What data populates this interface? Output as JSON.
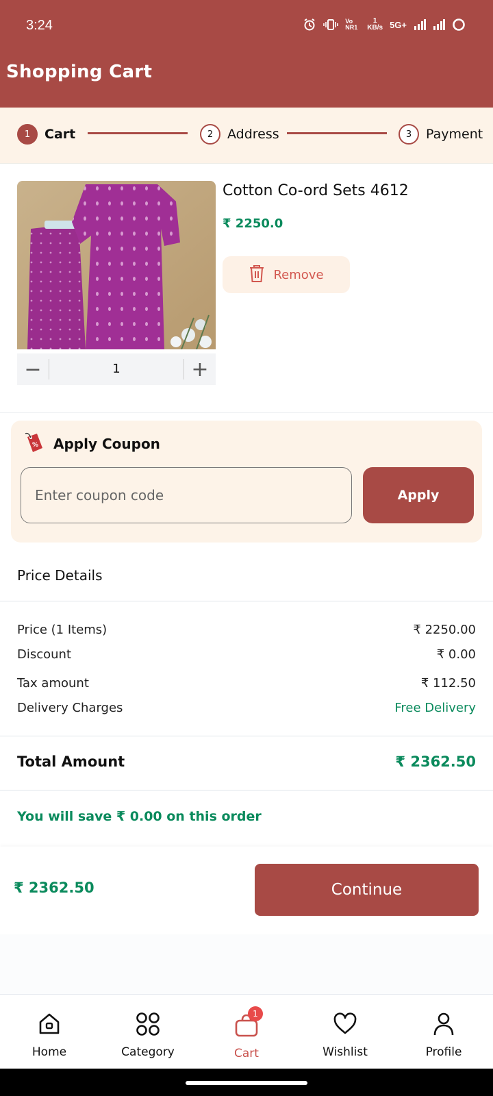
{
  "status": {
    "time": "3:24",
    "network": "5G+",
    "speed_top": "1",
    "speed_unit": "KB/s",
    "volte": "Vo NR1"
  },
  "header": {
    "title": "Shopping Cart"
  },
  "stepper": {
    "steps": [
      {
        "num": "1",
        "label": "Cart"
      },
      {
        "num": "2",
        "label": "Address"
      },
      {
        "num": "3",
        "label": "Payment"
      }
    ]
  },
  "item": {
    "name": "Cotton Co-ord Sets 4612",
    "price": "₹ 2250.0",
    "quantity": "1",
    "remove_label": "Remove",
    "qty_minus": "−",
    "qty_plus": "+"
  },
  "coupon": {
    "title": "Apply Coupon",
    "placeholder": "Enter coupon code",
    "apply_label": "Apply"
  },
  "price_details": {
    "title": "Price Details",
    "rows": [
      {
        "label": "Price (1 Items)",
        "value": "₹ 2250.00"
      },
      {
        "label": "Discount",
        "value": "₹ 0.00"
      },
      {
        "label": "Tax amount",
        "value": "₹ 112.50"
      },
      {
        "label": "Delivery Charges",
        "value": "Free Delivery"
      }
    ],
    "total_label": "Total Amount",
    "total_value": "₹ 2362.50",
    "savings": "You will save ₹ 0.00 on this order"
  },
  "checkout": {
    "total": "₹ 2362.50",
    "continue_label": "Continue"
  },
  "nav": {
    "items": [
      {
        "label": "Home"
      },
      {
        "label": "Category"
      },
      {
        "label": "Cart",
        "badge": "1"
      },
      {
        "label": "Wishlist"
      },
      {
        "label": "Profile"
      }
    ]
  },
  "colors": {
    "brand": "#a84a45",
    "accent_green": "#0a8a5c",
    "cream": "#fdf3e8",
    "badge_red": "#e84a4a"
  }
}
